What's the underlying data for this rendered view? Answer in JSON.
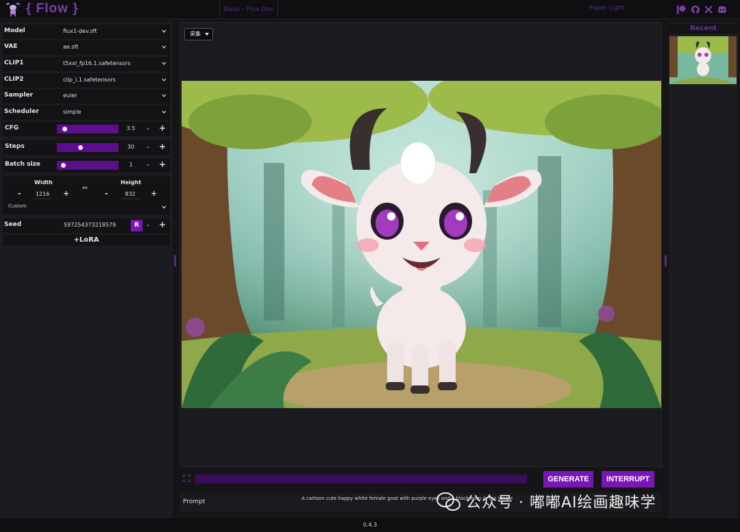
{
  "header": {
    "logo_text": "{ Flow }",
    "workflow_tab": "Basic - Flux Dev",
    "theme_label": "Paper Light",
    "icons": [
      "patreon-icon",
      "github-icon",
      "x-icon",
      "discord-icon"
    ]
  },
  "settings": {
    "model": {
      "label": "Model",
      "value": "flux1-dev.sft"
    },
    "vae": {
      "label": "VAE",
      "value": "ae.sft"
    },
    "clip1": {
      "label": "CLIP1",
      "value": "t5xxl_fp16.1.safetensors"
    },
    "clip2": {
      "label": "CLIP2",
      "value": "clip_l.1.safetensors"
    },
    "sampler": {
      "label": "Sampler",
      "value": "euler"
    },
    "scheduler": {
      "label": "Scheduler",
      "value": "simple"
    },
    "cfg": {
      "label": "CFG",
      "value": "3.5",
      "level": 0.05
    },
    "steps": {
      "label": "Steps",
      "value": "30",
      "level": 0.33
    },
    "batch": {
      "label": "Batch size",
      "value": "1",
      "level": 0.02
    },
    "width": {
      "label": "Width",
      "value": "1216"
    },
    "height": {
      "label": "Height",
      "value": "832"
    },
    "size_preset": "Custom",
    "seed": {
      "label": "Seed",
      "value": "597254373218579",
      "random_label": "R"
    },
    "lora_label": "+LoRA",
    "minus": "-",
    "plus": "+",
    "swap": "↔"
  },
  "main": {
    "sampler_pill": "采集"
  },
  "actions": {
    "generate": "GENERATE",
    "interrupt": "INTERRUPT"
  },
  "prompt": {
    "label": "Prompt",
    "text": "A cartoon cute happy white female goat with purple eyes and a black horn in the jungle"
  },
  "recent": {
    "title": "Recent"
  },
  "footer": {
    "version": "0.4.3"
  },
  "watermark": "公众号 · 嘟嘟AI绘画趣味学",
  "colors": {
    "accent": "#7a16b6",
    "slider": "#5b0f8c",
    "logo": "#7a3fa8",
    "background": "#151518"
  }
}
